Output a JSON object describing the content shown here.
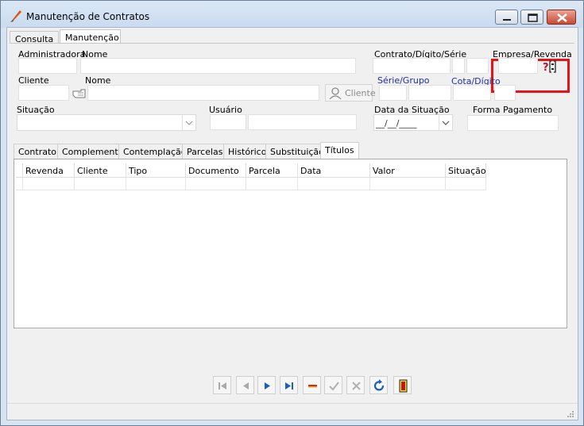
{
  "window": {
    "title": "Manutenção de Contratos"
  },
  "outer_tabs": [
    {
      "label": "Consulta"
    },
    {
      "label": "Manutenção"
    }
  ],
  "form": {
    "administradora_label": "Administradora",
    "nome_label": "Nome",
    "contrato_label": "Contrato/Dígito/Série",
    "empresa_label": "Empresa/Revenda",
    "cliente_label": "Cliente",
    "cliente_nome_label": "Nome",
    "serie_grupo_label": "Série/Grupo",
    "cota_digito_label": "Cota/Dígito",
    "cliente_button_label": "Cliente",
    "situacao_label": "Situação",
    "usuario_label": "Usuário",
    "data_situacao_label": "Data da Situação",
    "data_situacao_value": "__/__/____",
    "forma_pagamento_label": "Forma Pagamento"
  },
  "inner_tabs": [
    {
      "label": "Contrato"
    },
    {
      "label": "Complemento"
    },
    {
      "label": "Contemplação"
    },
    {
      "label": "Parcelas"
    },
    {
      "label": "Histórico"
    },
    {
      "label": "Substituição"
    },
    {
      "label": "Títulos"
    }
  ],
  "grid": {
    "columns": [
      "Revenda",
      "Cliente",
      "Tipo",
      "Documento",
      "Parcela",
      "Data",
      "Valor",
      "Situação"
    ]
  },
  "navigator": [
    "first-icon",
    "prior-icon",
    "next-icon",
    "last-icon",
    "delete-icon",
    "post-icon",
    "cancel-icon",
    "refresh-icon",
    "exit-icon"
  ],
  "colors": {
    "highlight_box": "#e5141b",
    "blue_label": "#1e2f9a"
  }
}
